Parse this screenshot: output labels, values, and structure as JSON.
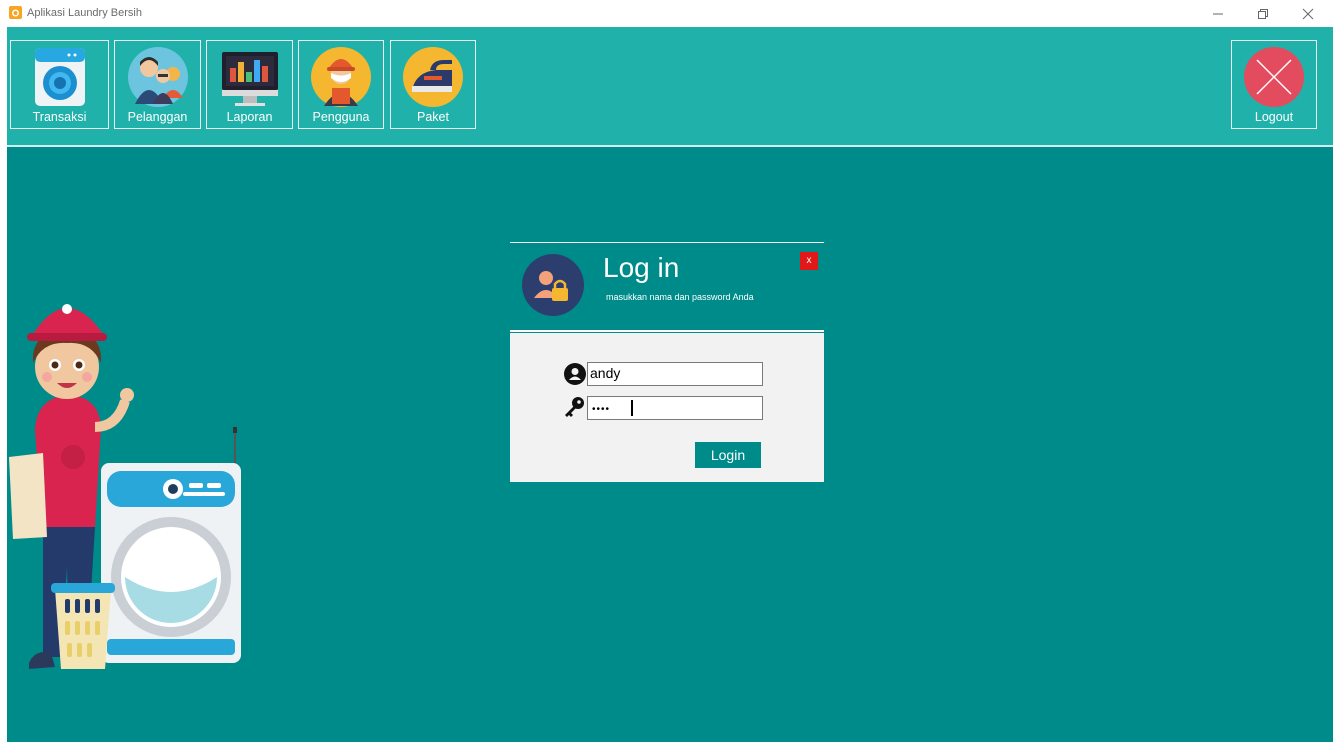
{
  "window": {
    "title": "Aplikasi Laundry Bersih"
  },
  "toolbar": {
    "buttons": [
      {
        "label": "Transaksi",
        "icon": "washing-machine-icon"
      },
      {
        "label": "Pelanggan",
        "icon": "customers-icon"
      },
      {
        "label": "Laporan",
        "icon": "report-monitor-icon"
      },
      {
        "label": "Pengguna",
        "icon": "worker-icon"
      },
      {
        "label": "Paket",
        "icon": "iron-icon"
      }
    ],
    "logout": {
      "label": "Logout",
      "icon": "close-x-icon"
    }
  },
  "login": {
    "title": "Log in",
    "subtitle": "masukkan nama dan password Anda",
    "close_label": "x",
    "username": "andy",
    "password_mask": "••••",
    "button_label": "Login"
  },
  "colors": {
    "toolbar": "#20b2aa",
    "main": "#008b8b",
    "close": "#e11818",
    "logout": "#e34b5e"
  }
}
